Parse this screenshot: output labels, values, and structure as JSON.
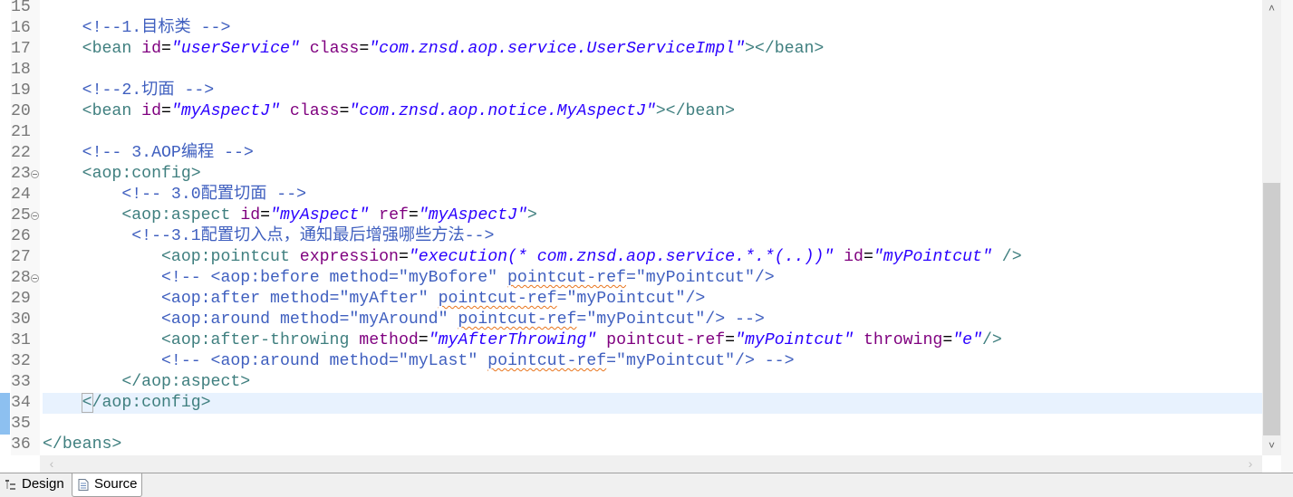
{
  "editor": {
    "current_line": 34,
    "lines": [
      {
        "n": "15",
        "fold": false,
        "tokens": []
      },
      {
        "n": "16",
        "fold": false,
        "tokens": [
          [
            "p",
            "    "
          ],
          [
            "c",
            "<!--1.目标类 -->"
          ]
        ]
      },
      {
        "n": "17",
        "fold": false,
        "tokens": [
          [
            "p",
            "    "
          ],
          [
            "t",
            "<bean "
          ],
          [
            "a",
            "id"
          ],
          [
            "e",
            "="
          ],
          [
            "v",
            "\"userService\""
          ],
          [
            "p",
            " "
          ],
          [
            "a",
            "class"
          ],
          [
            "e",
            "="
          ],
          [
            "v",
            "\"com.znsd.aop.service.UserServiceImpl\""
          ],
          [
            "t",
            "></bean>"
          ]
        ]
      },
      {
        "n": "18",
        "fold": false,
        "tokens": []
      },
      {
        "n": "19",
        "fold": false,
        "tokens": [
          [
            "p",
            "    "
          ],
          [
            "c",
            "<!--2.切面 -->"
          ]
        ]
      },
      {
        "n": "20",
        "fold": false,
        "tokens": [
          [
            "p",
            "    "
          ],
          [
            "t",
            "<bean "
          ],
          [
            "a",
            "id"
          ],
          [
            "e",
            "="
          ],
          [
            "v",
            "\"myAspectJ\""
          ],
          [
            "p",
            " "
          ],
          [
            "a",
            "class"
          ],
          [
            "e",
            "="
          ],
          [
            "v",
            "\"com.znsd.aop.notice.MyAspectJ\""
          ],
          [
            "t",
            "></bean>"
          ]
        ]
      },
      {
        "n": "21",
        "fold": false,
        "tokens": []
      },
      {
        "n": "22",
        "fold": false,
        "tokens": [
          [
            "p",
            "    "
          ],
          [
            "c",
            "<!-- 3.AOP编程 -->"
          ]
        ]
      },
      {
        "n": "23",
        "fold": true,
        "tokens": [
          [
            "p",
            "    "
          ],
          [
            "t",
            "<aop:config>"
          ]
        ]
      },
      {
        "n": "24",
        "fold": false,
        "tokens": [
          [
            "p",
            "        "
          ],
          [
            "c",
            "<!-- 3.0配置切面 -->"
          ]
        ]
      },
      {
        "n": "25",
        "fold": true,
        "tokens": [
          [
            "p",
            "        "
          ],
          [
            "t",
            "<aop:aspect "
          ],
          [
            "a",
            "id"
          ],
          [
            "e",
            "="
          ],
          [
            "v",
            "\"myAspect\""
          ],
          [
            "p",
            " "
          ],
          [
            "a",
            "ref"
          ],
          [
            "e",
            "="
          ],
          [
            "v",
            "\"myAspectJ\""
          ],
          [
            "t",
            ">"
          ]
        ]
      },
      {
        "n": "26",
        "fold": false,
        "tokens": [
          [
            "p",
            "         "
          ],
          [
            "c",
            "<!--3.1配置切入点，通知最后增强哪些方法-->"
          ]
        ]
      },
      {
        "n": "27",
        "fold": false,
        "tokens": [
          [
            "p",
            "            "
          ],
          [
            "t",
            "<aop:pointcut "
          ],
          [
            "a",
            "expression"
          ],
          [
            "e",
            "="
          ],
          [
            "v",
            "\"execution(* com.znsd.aop.service.*.*(..))\""
          ],
          [
            "p",
            " "
          ],
          [
            "a",
            "id"
          ],
          [
            "e",
            "="
          ],
          [
            "v",
            "\"myPointcut\""
          ],
          [
            "t",
            " />"
          ]
        ]
      },
      {
        "n": "28",
        "fold": true,
        "tokens": [
          [
            "p",
            "            "
          ],
          [
            "c",
            "<!-- <aop:before method=\"myBofore\" "
          ],
          [
            "s",
            "pointcut-ref"
          ],
          [
            "c",
            "=\"myPointcut\"/>"
          ]
        ]
      },
      {
        "n": "29",
        "fold": false,
        "tokens": [
          [
            "p",
            "            "
          ],
          [
            "c",
            "<aop:after method=\"myAfter\" "
          ],
          [
            "s",
            "pointcut-ref"
          ],
          [
            "c",
            "=\"myPointcut\"/>"
          ]
        ]
      },
      {
        "n": "30",
        "fold": false,
        "tokens": [
          [
            "p",
            "            "
          ],
          [
            "c",
            "<aop:around method=\"myAround\" "
          ],
          [
            "s",
            "pointcut-ref"
          ],
          [
            "c",
            "=\"myPointcut\"/> -->"
          ]
        ]
      },
      {
        "n": "31",
        "fold": false,
        "tokens": [
          [
            "p",
            "            "
          ],
          [
            "t",
            "<aop:after-throwing "
          ],
          [
            "a",
            "method"
          ],
          [
            "e",
            "="
          ],
          [
            "v",
            "\"myAfterThrowing\""
          ],
          [
            "p",
            " "
          ],
          [
            "a",
            "pointcut-ref"
          ],
          [
            "e",
            "="
          ],
          [
            "v",
            "\"myPointcut\""
          ],
          [
            "p",
            " "
          ],
          [
            "a",
            "throwing"
          ],
          [
            "e",
            "="
          ],
          [
            "v",
            "\"e\""
          ],
          [
            "t",
            "/>"
          ]
        ]
      },
      {
        "n": "32",
        "fold": false,
        "tokens": [
          [
            "p",
            "            "
          ],
          [
            "c",
            "<!-- <aop:around method=\"myLast\" "
          ],
          [
            "s",
            "pointcut-ref"
          ],
          [
            "c",
            "=\"myPointcut\"/> -->"
          ]
        ]
      },
      {
        "n": "33",
        "fold": false,
        "tokens": [
          [
            "p",
            "        "
          ],
          [
            "t",
            "</aop:aspect>"
          ]
        ]
      },
      {
        "n": "34",
        "fold": false,
        "tokens": [
          [
            "p",
            "    "
          ],
          [
            "b",
            "<"
          ],
          [
            "t",
            "/aop:config>"
          ]
        ]
      },
      {
        "n": "35",
        "fold": false,
        "tokens": []
      },
      {
        "n": "36",
        "fold": false,
        "tokens": [
          [
            "t",
            "</beans>"
          ]
        ]
      }
    ]
  },
  "tabs": [
    {
      "label": "Design",
      "icon": "tree-icon",
      "active": false
    },
    {
      "label": "Source",
      "icon": "document-icon",
      "active": true
    }
  ],
  "scrollbar": {
    "vertical_thumb_position_percent": 40
  }
}
